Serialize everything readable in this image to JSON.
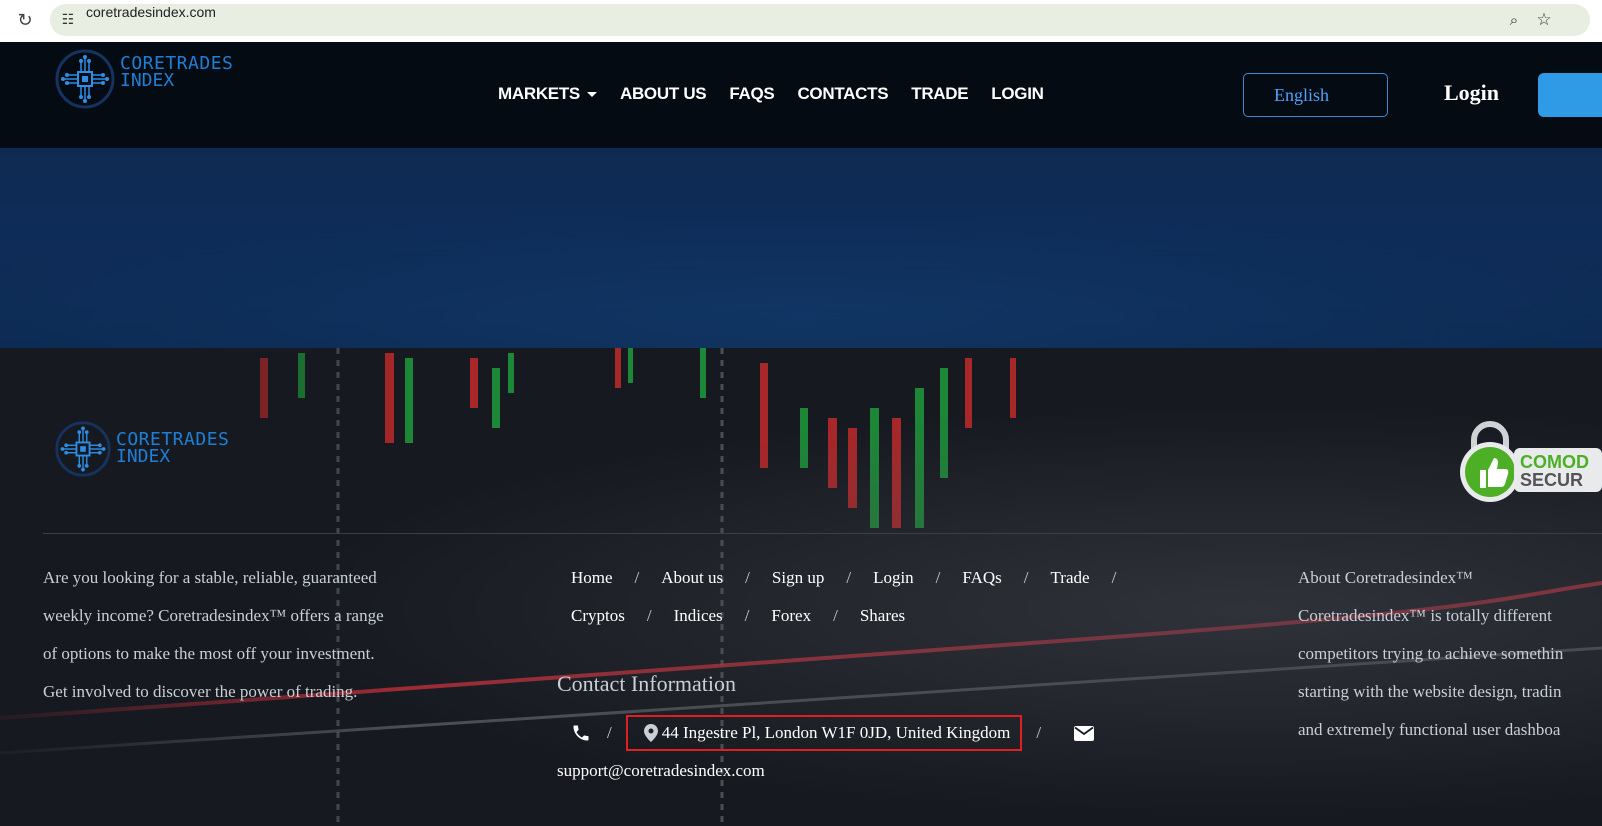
{
  "browser": {
    "url": "coretradesindex.com"
  },
  "header": {
    "logo": {
      "line1": "CORETRADES",
      "line2": "INDEX"
    },
    "nav": [
      {
        "label": "MARKETS",
        "dropdown": true
      },
      {
        "label": "ABOUT US"
      },
      {
        "label": "FAQS"
      },
      {
        "label": "CONTACTS"
      },
      {
        "label": "TRADE"
      },
      {
        "label": "LOGIN"
      }
    ],
    "language": "English",
    "login": "Login"
  },
  "footer": {
    "logo": {
      "line1": "CORETRADES",
      "line2": "INDEX"
    },
    "seal": {
      "text": "COMOD",
      "text2": "SECUR"
    },
    "intro": [
      "Are you looking for a stable, reliable, guaranteed",
      "weekly income? Coretradesindex™ offers a range",
      "of options to make the most off your investment.",
      "Get involved to discover the power of trading."
    ],
    "links_row1": [
      "Home",
      "About us",
      "Sign up",
      "Login",
      "FAQs",
      "Trade"
    ],
    "links_row2": [
      "Cryptos",
      "Indices",
      "Forex",
      "Shares"
    ],
    "separator": "/",
    "contact_title": "Contact Information",
    "address": "44 Ingestre Pl, London W1F 0JD, United Kingdom",
    "email": "support@coretradesindex.com",
    "about_title": "About Coretradesindex™",
    "about": [
      "Coretradesindex™ is totally different",
      "competitors trying to achieve somethin",
      "starting with the website design, tradin",
      "and extremely functional user dashboa"
    ]
  },
  "colors": {
    "accent": "#2f9be6",
    "highlight_border": "#e02020",
    "logo_blue": "#1e7fd6"
  }
}
